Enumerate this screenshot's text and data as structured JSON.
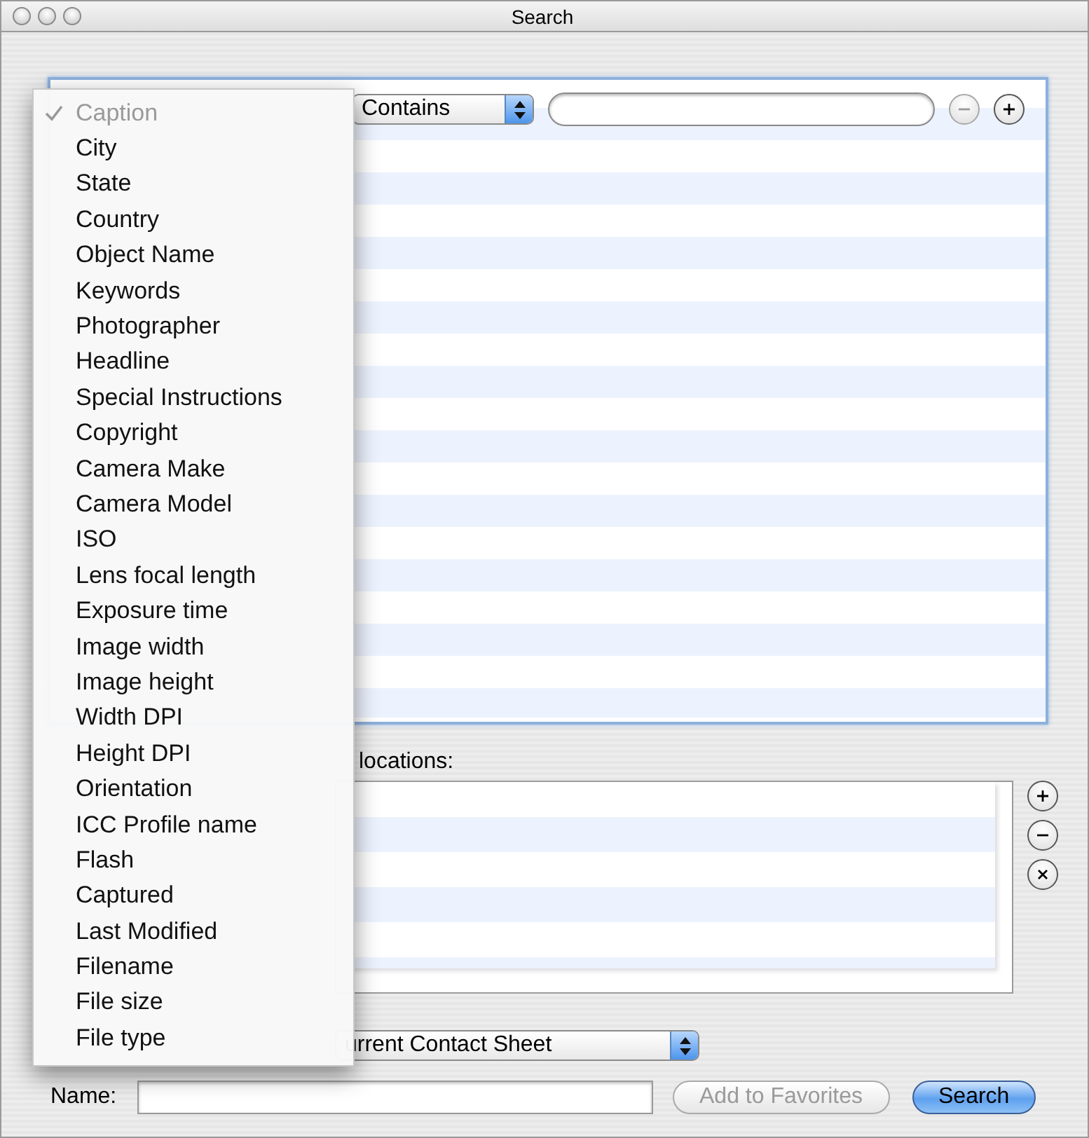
{
  "window": {
    "title": "Search",
    "active": false
  },
  "criteria": {
    "operator": "Contains",
    "remove_disabled": true
  },
  "locations": {
    "label": "locations:"
  },
  "output": {
    "destination": "urrent Contact Sheet"
  },
  "name_field": {
    "label": "Name:"
  },
  "buttons": [
    {
      "label": "Add to Favorites",
      "kind": "secondary",
      "disabled": true
    },
    {
      "label": "Search",
      "kind": "default",
      "disabled": false
    }
  ],
  "field_menu": [
    {
      "label": "Caption",
      "checked": true,
      "disabled": true
    },
    {
      "label": "City",
      "checked": false,
      "disabled": false
    },
    {
      "label": "State",
      "checked": false,
      "disabled": false
    },
    {
      "label": "Country",
      "checked": false,
      "disabled": false
    },
    {
      "label": "Object Name",
      "checked": false,
      "disabled": false
    },
    {
      "label": "Keywords",
      "checked": false,
      "disabled": false
    },
    {
      "label": "Photographer",
      "checked": false,
      "disabled": false
    },
    {
      "label": "Headline",
      "checked": false,
      "disabled": false
    },
    {
      "label": "Special Instructions",
      "checked": false,
      "disabled": false
    },
    {
      "label": "Copyright",
      "checked": false,
      "disabled": false
    },
    {
      "label": "Camera Make",
      "checked": false,
      "disabled": false
    },
    {
      "label": "Camera Model",
      "checked": false,
      "disabled": false
    },
    {
      "label": "ISO",
      "checked": false,
      "disabled": false
    },
    {
      "label": "Lens focal length",
      "checked": false,
      "disabled": false
    },
    {
      "label": "Exposure time",
      "checked": false,
      "disabled": false
    },
    {
      "label": "Image width",
      "checked": false,
      "disabled": false
    },
    {
      "label": "Image height",
      "checked": false,
      "disabled": false
    },
    {
      "label": "Width DPI",
      "checked": false,
      "disabled": false
    },
    {
      "label": "Height DPI",
      "checked": false,
      "disabled": false
    },
    {
      "label": "Orientation",
      "checked": false,
      "disabled": false
    },
    {
      "label": "ICC Profile name",
      "checked": false,
      "disabled": false
    },
    {
      "label": "Flash",
      "checked": false,
      "disabled": false
    },
    {
      "label": "Captured",
      "checked": false,
      "disabled": false
    },
    {
      "label": "Last Modified",
      "checked": false,
      "disabled": false
    },
    {
      "label": "Filename",
      "checked": false,
      "disabled": false
    },
    {
      "label": "File size",
      "checked": false,
      "disabled": false
    },
    {
      "label": "File type",
      "checked": false,
      "disabled": false
    }
  ]
}
